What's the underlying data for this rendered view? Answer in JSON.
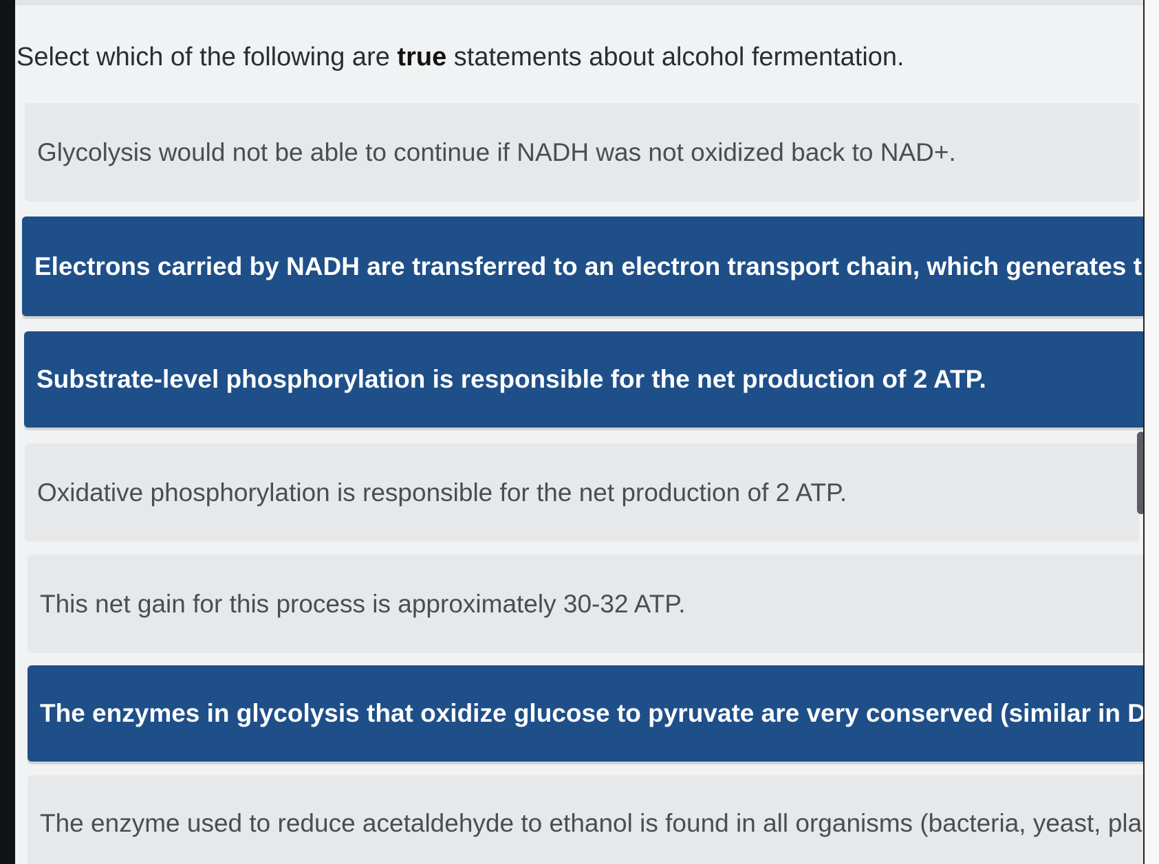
{
  "question": {
    "prefix": "Select which of the following are ",
    "emphasis": "true",
    "suffix": " statements about alcohol fermentation."
  },
  "options": [
    {
      "text": "Glycolysis would not be able to continue if NADH was not oxidized back to NAD+.",
      "selected": false
    },
    {
      "text": "Electrons carried by NADH are transferred to an electron transport chain, which generates the NAD+",
      "selected": true
    },
    {
      "text": "Substrate-level phosphorylation is responsible for the net production of 2 ATP.",
      "selected": true
    },
    {
      "text": "Oxidative phosphorylation is responsible for the net production of 2 ATP.",
      "selected": false
    },
    {
      "text": "This net gain for this process is approximately 30-32 ATP.",
      "selected": false
    },
    {
      "text": "The enzymes in glycolysis that oxidize glucose to pyruvate are very conserved (similar in DNA seque",
      "selected": true
    },
    {
      "text": "The enzyme used to reduce acetaldehyde to ethanol is found in all organisms (bacteria, yeast, plants",
      "selected": false
    }
  ],
  "colors": {
    "selected_bg": "#1f4f89",
    "unselected_bg": "#e6e8ea",
    "page_bg": "#f1f2f3"
  }
}
